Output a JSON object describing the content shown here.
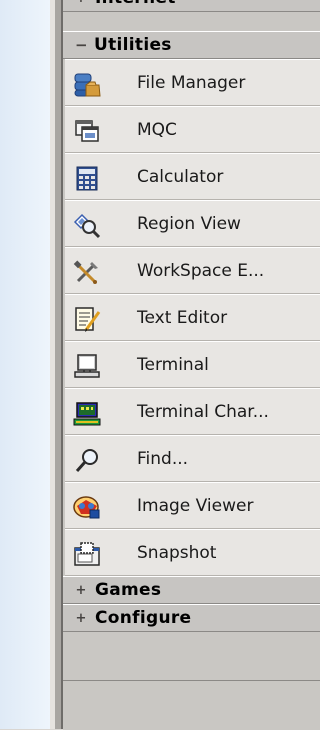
{
  "menu": {
    "cut_top_header": {
      "sign": "+",
      "label": "Internet"
    },
    "utilities": {
      "sign": "−",
      "label": "Utilities",
      "items": [
        {
          "label": "File Manager",
          "icon": "file-manager-icon"
        },
        {
          "label": "MQC",
          "icon": "mqc-icon"
        },
        {
          "label": "Calculator",
          "icon": "calculator-icon"
        },
        {
          "label": "Region View",
          "icon": "region-view-icon"
        },
        {
          "label": "WorkSpace E...",
          "icon": "workspace-tools-icon"
        },
        {
          "label": "Text Editor",
          "icon": "text-editor-icon"
        },
        {
          "label": "Terminal",
          "icon": "terminal-icon"
        },
        {
          "label": "Terminal Char...",
          "icon": "terminal-char-icon"
        },
        {
          "label": "Find...",
          "icon": "find-icon"
        },
        {
          "label": "Image Viewer",
          "icon": "image-viewer-icon"
        },
        {
          "label": "Snapshot",
          "icon": "snapshot-icon"
        }
      ]
    },
    "games": {
      "sign": "+",
      "label": "Games"
    },
    "configure": {
      "sign": "+",
      "label": "Configure"
    }
  },
  "colors": {
    "panel_bg": "#c9c7c3",
    "item_bg": "#e8e6e3",
    "left_strip": "#e8f1fa"
  }
}
